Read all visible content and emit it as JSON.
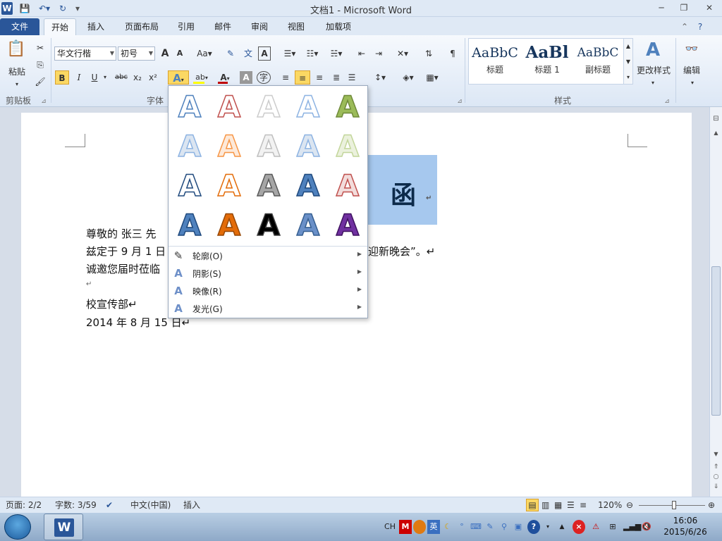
{
  "window": {
    "title": "文档1 - Microsoft Word"
  },
  "tabs": [
    {
      "label": "文件"
    },
    {
      "label": "开始"
    },
    {
      "label": "插入"
    },
    {
      "label": "页面布局"
    },
    {
      "label": "引用"
    },
    {
      "label": "邮件"
    },
    {
      "label": "审阅"
    },
    {
      "label": "视图"
    },
    {
      "label": "加载项"
    }
  ],
  "ribbon": {
    "clipboard": {
      "paste": "粘贴",
      "group": "剪贴板"
    },
    "font": {
      "name": "华文行楷",
      "size": "初号",
      "group": "字体",
      "grow": "A",
      "shrink": "A",
      "case": "Aa",
      "clear": "A",
      "bold": "B",
      "italic": "I",
      "underline": "U",
      "strike": "abc",
      "sub": "x₂",
      "sup": "x²"
    },
    "styles": {
      "group": "样式",
      "items": [
        {
          "preview": "AaBbC",
          "label": "标题"
        },
        {
          "preview": "AaBl",
          "label": "标题 1"
        },
        {
          "preview": "AaBbC",
          "label": "副标题"
        }
      ],
      "change": "更改样式"
    },
    "edit": {
      "label": "编辑"
    }
  },
  "document": {
    "banner_text": "函",
    "lines": [
      "尊敬的  张三  先",
      "兹定于 9 月 1 日",
      "诚邀您届时莅临",
      "↵",
      "校宣传部↵",
      "2014 年 8 月 15 日↵"
    ],
    "right_fragment": "迎新晚会”。↵"
  },
  "text_effects": {
    "menu": [
      {
        "label": "轮廓(O)",
        "icon": "pen-icon"
      },
      {
        "label": "阴影(S)",
        "icon": "shadow-a-icon"
      },
      {
        "label": "映像(R)",
        "icon": "reflection-a-icon"
      },
      {
        "label": "发光(G)",
        "icon": "glow-a-icon"
      }
    ],
    "swatch_letter": "A",
    "colors": {
      "blue": "#4f81bd",
      "red": "#c0504d",
      "gray": "#7f7f7f",
      "lightblue": "#8db3e2",
      "green": "#9bbb59",
      "orange": "#e36c09",
      "black": "#000000",
      "navy": "#1f497d",
      "purple": "#7030a0"
    }
  },
  "status": {
    "page": "页面: 2/2",
    "words": "字数: 3/59",
    "lang": "中文(中国)",
    "mode": "插入",
    "zoom": "120%"
  },
  "taskbar": {
    "ime": "CH",
    "time": "16:06",
    "date": "2015/6/26"
  }
}
